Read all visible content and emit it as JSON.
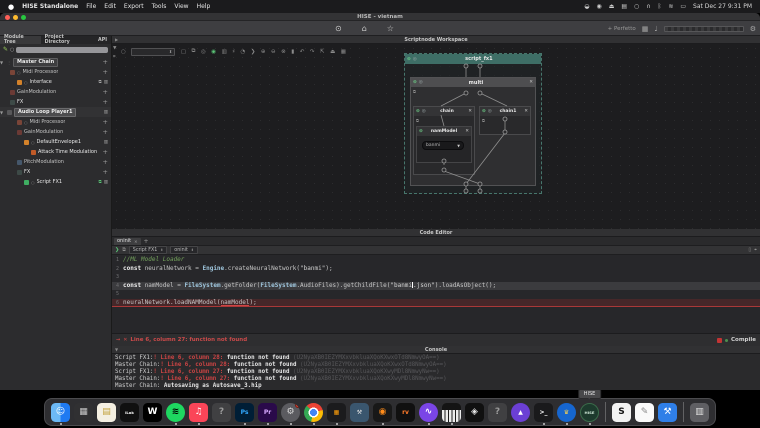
{
  "menu_bar": {
    "apple": "●",
    "app_name": "HISE Standalone",
    "items": [
      "File",
      "Edit",
      "Export",
      "Tools",
      "View",
      "Help"
    ],
    "status_icons": {
      "location": "◒",
      "record": "◉",
      "eject": "⏏",
      "display": "▤",
      "search": "○",
      "headphones": "∩",
      "bluetooth": "ᛒ",
      "wifi": "≋",
      "battery": "▭"
    },
    "clock": "Sat Dec 27 9:31 PM"
  },
  "window": {
    "title": "HISE - vietnam",
    "traffic": {
      "red": "#ff5f57",
      "yellow": "#febc2e",
      "green": "#28c840"
    },
    "toolbar": {
      "settings_icon": "⊙",
      "home_icon": "⌂",
      "star_icon": "☆",
      "preset_label": "+ Perfetto",
      "grid_icon": "▦",
      "midi_icon": "♩",
      "gear_icon": "⚙"
    }
  },
  "sidebar": {
    "tabs": [
      "Module Tree",
      "Project Directory",
      "API"
    ],
    "search": {
      "pencil_icon": "✎",
      "search_icon": "○",
      "placeholder": ""
    },
    "tree": [
      {
        "label": "Master Chain",
        "color": "#3d3d3f"
      },
      {
        "label": "Midi Processor",
        "color": "#7a4538"
      },
      {
        "label": "Interface",
        "color": "#d4822a"
      },
      {
        "label": "GainModulation",
        "color": "#6b3a35"
      },
      {
        "label": "FX",
        "color": "#3d4a47"
      },
      {
        "label": "Audio Loop Player1",
        "color": "#58585a"
      },
      {
        "label": "Midi Processor",
        "color": "#7a4538"
      },
      {
        "label": "GainModulation",
        "color": "#6b3a35"
      },
      {
        "label": "DefaultEnvelope1",
        "color": "#d4822a"
      },
      {
        "label": "Attack Time Modulation",
        "color": "#c05a28"
      },
      {
        "label": "PitchModulation",
        "color": "#45576b"
      },
      {
        "label": "FX",
        "color": "#3d4a47"
      },
      {
        "label": "Script FX1",
        "color": "#3fae62"
      }
    ],
    "row_icons": {
      "plus": "+",
      "trash": "▥",
      "link": "⧉",
      "circle": "○",
      "arrow": "▼",
      "handle": "⋮"
    }
  },
  "workspace": {
    "header": "Scriptnode Workspace",
    "header_arrow": "▶",
    "rail_icons": {
      "filter": "▼",
      "grid": "⌗"
    },
    "toolbar": {
      "search_icon": "○",
      "select_caret": "⬍",
      "icons": [
        "▢",
        "⧉",
        "◎",
        "◉",
        "▥",
        "♯",
        "◔",
        "❯",
        "⊕",
        "⊖",
        "⊗",
        "▮",
        "↶",
        "↷",
        "⇱",
        "⏏",
        "▦"
      ]
    },
    "graph": {
      "power_icon": "⊙",
      "bypass_icon": "◎",
      "close_icon": "✕",
      "param_icon": "⧉",
      "script_node": "script_fx1",
      "multi_node": "multi",
      "chain_node": "chain",
      "chain1_node": "chain1",
      "nam_node": "namModel",
      "dropdown_value": "banmi",
      "dropdown_caret": "▼",
      "script_header_color": "#3e6e66"
    }
  },
  "code_editor": {
    "panel_title": "Code Editor",
    "tab": "oninit",
    "tab_close": "✕",
    "tab_add": "+",
    "run_icon": "❯",
    "copy_icon": "⧉",
    "breadcrumb1": "Script FX1",
    "breadcrumb2": "oninit",
    "crumb_caret": "⬍",
    "bookmark_icon": "▯",
    "find_icon": "⌖",
    "lines": [
      {
        "n": "1",
        "cm": "//ML Model Loader"
      },
      {
        "n": "2",
        "kw": "const ",
        "p1": "neuralNetwork = ",
        "cls": "Engine",
        "p2": ".createNeuralNetwork(",
        "str": "\"banmi\"",
        "p3": ");"
      },
      {
        "n": "3"
      },
      {
        "n": "4",
        "kw": "const ",
        "p1": "namModel = ",
        "cls": "FileSystem",
        "p2": ".getFolder(",
        "cls2": "FileSystem",
        "p3": ".AudioFiles).getChildFile(",
        "strA": "\"banmi",
        "strB": ".json\"",
        "p4": ").loadAsObject();"
      },
      {
        "n": "5"
      },
      {
        "n": "6",
        "p1": "neuralNetwork.loadNAMModel(",
        "err": "namModel",
        "p2": ");"
      }
    ],
    "error_bar": {
      "arrow_icon": "→",
      "x_icon": "✕",
      "text": "Line 6, column 27: function not found",
      "compile_label": "Compile"
    }
  },
  "console": {
    "title": "Console",
    "filter_icon": "▼",
    "lines": [
      {
        "src": "Script FX1:",
        "loc": "! Line 6, column 28:",
        "msg": " function not found ",
        "hash": "(U2NyaXB0IEZYMXxvbkluaXQoKXwxOTd8NmwyOA==)"
      },
      {
        "src": "Master Chain:",
        "loc": "! Line 6, column 28:",
        "msg": " function not found ",
        "hash": "(U2NyaXB0IEZYMXxvbkluaXQoKXwxOTd8NmwyOA==)"
      },
      {
        "src": "Script FX1:",
        "loc": "! Line 6, column 27:",
        "msg": " function not found ",
        "hash": "(U2NyaXB0IEZYMXxvbkluaXQoKXwyMDl8NmwyNw==)"
      },
      {
        "src": "Master Chain:",
        "loc": "! Line 6, column 27:",
        "msg": " function not found ",
        "hash": "(U2NyaXB0IEZYMXxvbkluaXQoKXwyMDl8NmwyNw==)"
      },
      {
        "src": "Master Chain:",
        "loc": "",
        "msg": " Autosaving as Autosave_3.hip",
        "hash": ""
      }
    ]
  },
  "dock": {
    "tooltip": "HISE",
    "items": [
      {
        "glyph": "☺",
        "fg": "#ffffff",
        "bg": "",
        "running": true
      },
      {
        "glyph": "▦",
        "fg": "#c8c8c8",
        "bg": "#303032",
        "running": false
      },
      {
        "glyph": "▤",
        "fg": "#c2a23c",
        "bg": "#f4efe2",
        "running": false
      },
      {
        "glyph": "iLok",
        "fg": "#ffffff",
        "bg": "#101010",
        "running": false
      },
      {
        "glyph": "W",
        "fg": "#ffffff",
        "bg": "#000000",
        "running": false
      },
      {
        "glyph": "≋",
        "fg": "#000000",
        "bg": "#1ed760",
        "running": true
      },
      {
        "glyph": "♫",
        "fg": "#ffffff",
        "bg": "#fb4558",
        "running": true
      },
      {
        "glyph": "?",
        "fg": "#9a9a9a",
        "bg": "rgba(120,120,120,0.25)",
        "running": false
      },
      {
        "glyph": "Ps",
        "fg": "#31a8ff",
        "bg": "#001e36",
        "running": true
      },
      {
        "glyph": "Pr",
        "fg": "#d8a9ff",
        "bg": "#2a0a4a",
        "running": true
      },
      {
        "glyph": "⚙",
        "fg": "#d8d8d8",
        "bg": "#5b5b60",
        "running": true
      },
      {
        "glyph": "",
        "fg": "#ffffff",
        "bg": "",
        "running": true
      },
      {
        "glyph": "▦",
        "fg": "#ff9f0a",
        "bg": "#1b1b1d",
        "running": true
      },
      {
        "glyph": "⚒",
        "fg": "#e0e0e0",
        "bg": "#3a566e",
        "running": false
      },
      {
        "glyph": "◉",
        "fg": "#ff8c1a",
        "bg": "#181818",
        "running": true
      },
      {
        "glyph": "rv",
        "fg": "#ff7a2a",
        "bg": "#101010",
        "running": false
      },
      {
        "glyph": "∿",
        "fg": "#ffffff",
        "bg": "#7a45e6",
        "running": true
      },
      {
        "glyph": "",
        "fg": "#ffffff",
        "bg": "",
        "running": true
      },
      {
        "glyph": "◈",
        "fg": "#e8e8e8",
        "bg": "#101010",
        "running": false
      },
      {
        "glyph": "?",
        "fg": "#9a9a9a",
        "bg": "rgba(120,120,120,0.25)",
        "running": false
      },
      {
        "glyph": "▲",
        "fg": "#ffffff",
        "bg": "#6b3fd4",
        "running": false
      },
      {
        "glyph": ">_",
        "fg": "#ffffff",
        "bg": "#1a1a1c",
        "running": true
      },
      {
        "glyph": "♛",
        "fg": "#ffd34d",
        "bg": "#1666d0",
        "running": true
      },
      {
        "glyph": "HISE",
        "fg": "#cfe8d8",
        "bg": "#1d3a2d",
        "running": true
      },
      {
        "glyph": "S",
        "fg": "#141414",
        "bg": "#f2f2f2",
        "running": false
      },
      {
        "glyph": "✎",
        "fg": "#8a8a8a",
        "bg": "#fafafa",
        "running": false
      },
      {
        "glyph": "⚒",
        "fg": "#ffffff",
        "bg": "#2f7fe8",
        "running": false
      },
      {
        "glyph": "▥",
        "fg": "#e0e0e0",
        "bg": "rgba(210,210,215,0.3)",
        "running": false
      }
    ]
  }
}
